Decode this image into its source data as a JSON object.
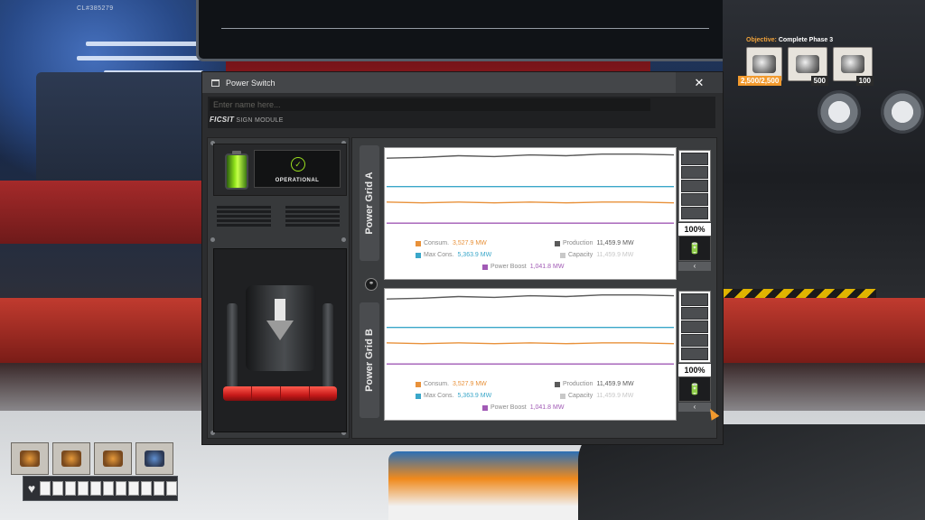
{
  "hud": {
    "coordinates": "CL#385279",
    "objective": {
      "label": "Objective:",
      "name": "Complete Phase 3"
    },
    "objective_items": [
      {
        "name": "item-1",
        "count": "2,500/2,500",
        "highlight": true
      },
      {
        "name": "item-2",
        "count": "500",
        "highlight": false
      },
      {
        "name": "item-3",
        "count": "100",
        "highlight": false
      }
    ]
  },
  "window": {
    "title": "Power Switch",
    "close_label": "✕",
    "name_placeholder": "Enter name here...",
    "module_brand": "FICSIT",
    "module_text": "SIGN MODULE",
    "status_label": "OPERATIONAL",
    "status_icon": "check-circle-icon",
    "status_color": "#9be01e"
  },
  "grids": [
    {
      "label": "Power Grid A",
      "consum_label": "Consum.",
      "consum_value": "3,527.9 MW",
      "production_label": "Production",
      "production_value": "11,459.9 MW",
      "maxcons_label": "Max Cons.",
      "maxcons_value": "5,363.9 MW",
      "capacity_label": "Capacity",
      "capacity_value": "11,459.9 MW",
      "boost_label": "Power Boost",
      "boost_value": "1,041.8 MW",
      "battery_percent": "100%"
    },
    {
      "label": "Power Grid B",
      "consum_label": "Consum.",
      "consum_value": "3,527.9 MW",
      "production_label": "Production",
      "production_value": "11,459.9 MW",
      "maxcons_label": "Max Cons.",
      "maxcons_value": "5,363.9 MW",
      "capacity_label": "Capacity",
      "capacity_value": "11,459.9 MW",
      "boost_label": "Power Boost",
      "boost_value": "1,041.8 MW",
      "battery_percent": "100%"
    }
  ],
  "colors": {
    "consum": "#e8913a",
    "production": "#5a5a5a",
    "maxcons": "#3aa7c9",
    "capacity": "#c8c8c8",
    "boost": "#a15ab5"
  },
  "graph_series": {
    "production": [
      0.92,
      0.93,
      0.95,
      0.94,
      0.96,
      0.95,
      0.97,
      0.97,
      0.96
    ],
    "capacity": [
      0.92,
      0.93,
      0.95,
      0.94,
      0.96,
      0.95,
      0.97,
      0.97,
      0.96
    ],
    "maxcons": [
      0.57,
      0.57,
      0.57,
      0.57,
      0.57,
      0.57,
      0.57,
      0.57,
      0.57
    ],
    "consum": [
      0.38,
      0.37,
      0.38,
      0.37,
      0.38,
      0.37,
      0.38,
      0.38,
      0.37
    ],
    "boost": [
      0.12,
      0.12,
      0.12,
      0.12,
      0.12,
      0.12,
      0.12,
      0.12,
      0.12
    ]
  },
  "health_cells": 11
}
